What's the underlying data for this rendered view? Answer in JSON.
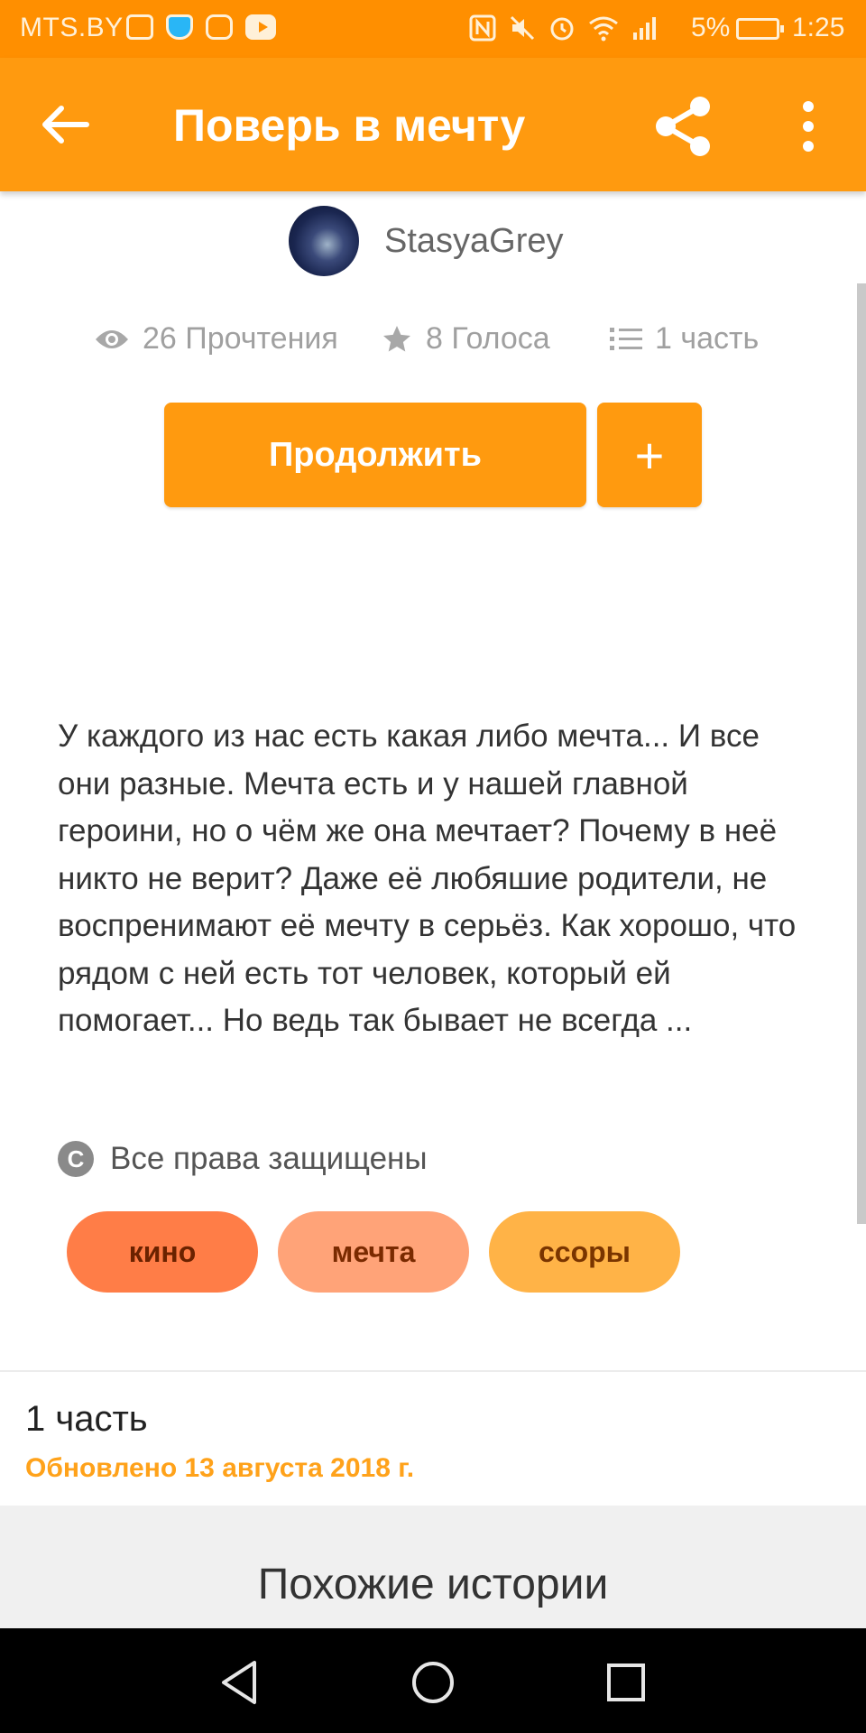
{
  "status_bar": {
    "carrier": "MTS.BY",
    "battery_percent": "5%",
    "time": "1:25",
    "icons": [
      "activity-icon",
      "shield-icon",
      "instagram-icon",
      "youtube-icon",
      "nfc-icon",
      "mute-icon",
      "alarm-icon",
      "wifi-icon",
      "signal-icon",
      "battery-icon"
    ]
  },
  "app_bar": {
    "title": "Поверь в мечту",
    "back_icon": "arrow-left-icon",
    "share_icon": "share-icon",
    "menu_icon": "more-vertical-icon"
  },
  "author": {
    "name": "StasyaGrey"
  },
  "stats": {
    "reads": "26 Прочтения",
    "votes": "8 Голоса",
    "parts": "1 часть"
  },
  "actions": {
    "continue_label": "Продолжить",
    "add_label": "+"
  },
  "description": "У каждого из нас есть какая либо мечта... И все они разные. Мечта есть и у нашей главной героини, но о чём же она мечтает? Почему в неё никто не верит? Даже её любяшие родители, не воспренимают её мечту в серьёз. Как хорошо, что рядом с ней есть тот человек, который ей помогает... Но ведь так бывает не всегда ...",
  "copyright": {
    "symbol": "C",
    "text": "Все права защищены"
  },
  "tags": [
    {
      "label": "кино",
      "bg": "#ff7d47",
      "fg": "#6b2200"
    },
    {
      "label": "мечта",
      "bg": "#ffa378",
      "fg": "#7a2a00"
    },
    {
      "label": "ссоры",
      "bg": "#ffb347",
      "fg": "#7a3500"
    }
  ],
  "part": {
    "title": "1 часть",
    "updated": "Обновлено 13 августа 2018 г."
  },
  "similar": {
    "title": "Похожие истории"
  },
  "colors": {
    "accent": "#ff9a0f",
    "status_bar": "#ff8f00",
    "updated_text": "#ffa21a"
  }
}
